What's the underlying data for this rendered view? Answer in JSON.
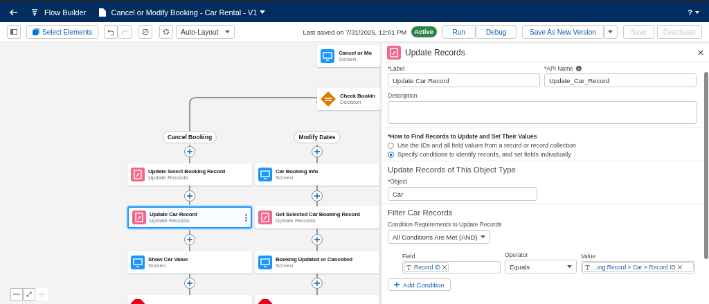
{
  "header": {
    "app": "Flow Builder",
    "flow_title": "Cancel or Modify Booking - Car Rental - V1",
    "help": "?"
  },
  "toolbar": {
    "select_elements": "Select Elements",
    "layout": "Auto-Layout",
    "last_saved": "Last saved on 7/31/2025, 12:01 PM",
    "status": "Active",
    "buttons": [
      {
        "label": "Run",
        "disabled": false
      },
      {
        "label": "Debug",
        "disabled": false
      }
    ],
    "save_as": "Save As New Version",
    "save": {
      "label": "Save",
      "disabled": true
    },
    "deactivate": {
      "label": "Deactivate",
      "disabled": true
    }
  },
  "canvas": {
    "top_nodes": [
      {
        "kind": "screen",
        "title": "Cancel or Mo",
        "subtitle": "Screen"
      },
      {
        "kind": "decision",
        "title": "Check Bookin",
        "subtitle": "Decision"
      }
    ],
    "branches": [
      {
        "label": "Cancel Booking",
        "nodes": [
          {
            "kind": "update",
            "title": "Update Select Booking Record",
            "subtitle": "Update Records",
            "selected": false
          },
          {
            "kind": "update",
            "title": "Update Car Record",
            "subtitle": "Update Records",
            "selected": true
          },
          {
            "kind": "screen",
            "title": "Show Car Value",
            "subtitle": "Screen",
            "selected": false
          },
          {
            "kind": "end",
            "selected": false
          }
        ]
      },
      {
        "label": "Modify Dates",
        "nodes": [
          {
            "kind": "screen",
            "title": "Car Booking Info",
            "subtitle": "Screen",
            "selected": false
          },
          {
            "kind": "update",
            "title": "Get Selected Car Booking Record",
            "subtitle": "Update Records",
            "selected": false
          },
          {
            "kind": "screen",
            "title": "Booking Updated or Cancelled",
            "subtitle": "Screen",
            "selected": false
          },
          {
            "kind": "end",
            "selected": false
          }
        ]
      }
    ]
  },
  "panel": {
    "title": "Update Records",
    "label": {
      "label": "*Label",
      "value": "Update Car Record"
    },
    "api_name": {
      "label": "*API Name",
      "value": "Update_Car_Record"
    },
    "description": {
      "label": "Description"
    },
    "how_to_find": {
      "label": "*How to Find Records to Update and Set Their Values",
      "options": [
        {
          "label": "Use the IDs and all field values from a record or record collection",
          "selected": false
        },
        {
          "label": "Specify conditions to identify records, and set fields individually",
          "selected": true
        }
      ]
    },
    "object_section": {
      "title": "Update Records of This Object Type",
      "label": "*Object",
      "value": "Car"
    },
    "filter_section": {
      "title": "Filter Car Records",
      "requirements_label": "Condition Requirements to Update Records",
      "requirements_value": "All Conditions Are Met (AND)",
      "condition": {
        "field_label": "Field",
        "field_value": "Record ID",
        "operator_label": "Operator",
        "operator_value": "Equals",
        "value_label": "Value",
        "value_value": "...ing Record > Car > Record ID"
      },
      "add_condition": "Add Condition"
    }
  }
}
